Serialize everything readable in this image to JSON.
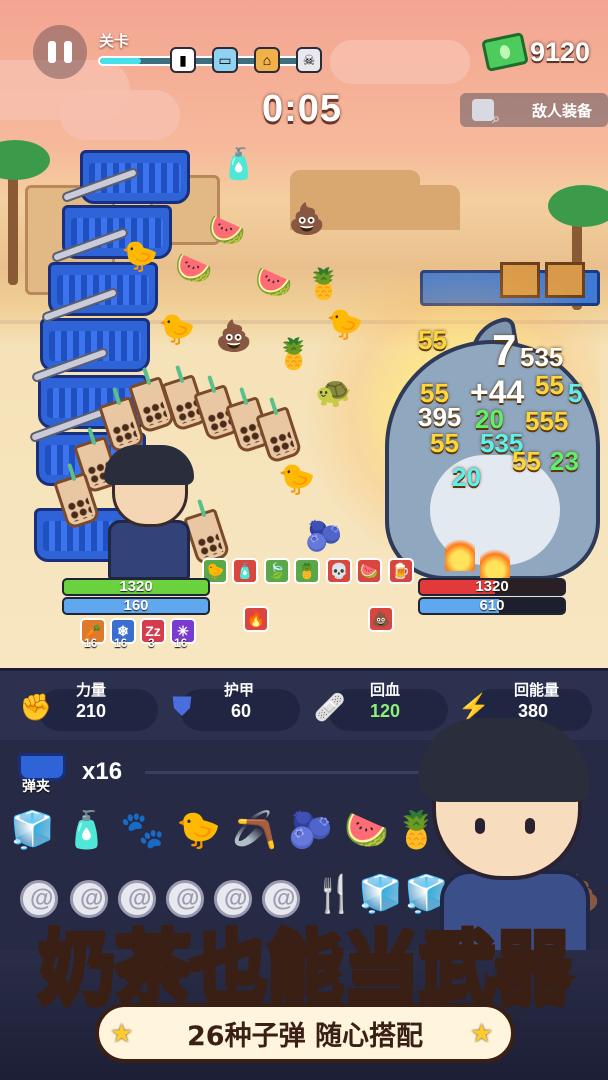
{
  "hud": {
    "level_label": "关卡",
    "level_progress": 0.2,
    "timer": "0:05",
    "money": "9120",
    "enemy_gear_label": "敌人装备"
  },
  "player": {
    "hp": "1320",
    "shield": "160",
    "hp_fraction": 1.0,
    "statuses": [
      {
        "icon": "carrot-icon",
        "count": "16"
      },
      {
        "icon": "snowflake-icon",
        "count": "16"
      },
      {
        "icon": "sleep-icon",
        "glyph": "Zz",
        "count": "3"
      },
      {
        "icon": "frost-icon",
        "count": "16"
      }
    ]
  },
  "enemy": {
    "hp": "1320",
    "shield": "610",
    "hp_fraction": 0.52
  },
  "damage_numbers": [
    "55",
    "7",
    "535",
    "55",
    "+44",
    "55",
    "5",
    "395",
    "20",
    "555",
    "55",
    "535",
    "55",
    "23",
    "20"
  ],
  "stats": {
    "power_label": "力量",
    "power_value": "210",
    "armor_label": "护甲",
    "armor_value": "60",
    "heal_label": "回血",
    "heal_value": "120",
    "energy_label": "回能量",
    "energy_value": "380"
  },
  "inventory": {
    "clip_label": "弹夹",
    "clip_count": "x16"
  },
  "promo": {
    "title": "奶茶也能当武器",
    "subtitle": "26种子弹 随心搭配"
  },
  "colors": {
    "hp_green": "#6bd23f",
    "shield_blue": "#5fa8f0",
    "enemy_hp_red": "#e23a3a",
    "heal_green": "#8cf07a",
    "promo_yellow": "#ffe14a"
  }
}
